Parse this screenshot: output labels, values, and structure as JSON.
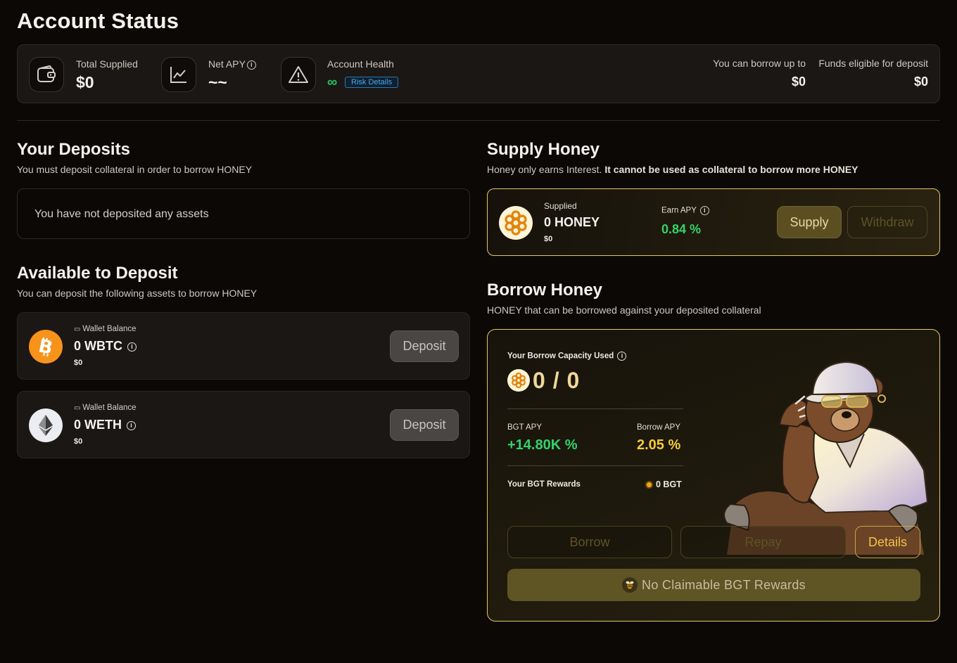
{
  "page": {
    "title": "Account Status"
  },
  "status": {
    "total_supplied_label": "Total Supplied",
    "total_supplied_value": "$0",
    "net_apy_label": "Net APY",
    "net_apy_value": "~~",
    "account_health_label": "Account Health",
    "account_health_value": "∞",
    "risk_details_label": "Risk Details",
    "borrow_up_to_label": "You can borrow up to",
    "borrow_up_to_value": "$0",
    "funds_eligible_label": "Funds eligible for deposit",
    "funds_eligible_value": "$0"
  },
  "deposits": {
    "title": "Your Deposits",
    "subtitle": "You must deposit collateral in order to borrow HONEY",
    "empty_text": "You have not deposited any assets"
  },
  "available": {
    "title": "Available to Deposit",
    "subtitle": "You can deposit the following assets to borrow HONEY",
    "assets": [
      {
        "wallet_label": "Wallet Balance",
        "amount": "0 WBTC",
        "usd": "$0",
        "button": "Deposit",
        "icon": "bitcoin-icon",
        "color": "#f7931a"
      },
      {
        "wallet_label": "Wallet Balance",
        "amount": "0 WETH",
        "usd": "$0",
        "button": "Deposit",
        "icon": "ethereum-icon",
        "color": "#ecedf0"
      }
    ]
  },
  "supply": {
    "title": "Supply Honey",
    "subtitle_plain": "Honey only earns Interest.",
    "subtitle_bold": "It cannot be used as collateral to borrow more HONEY",
    "supplied_label": "Supplied",
    "supplied_amount": "0 HONEY",
    "supplied_usd": "$0",
    "earn_apy_label": "Earn APY",
    "earn_apy_value": "0.84 %",
    "supply_button": "Supply",
    "withdraw_button": "Withdraw"
  },
  "borrow": {
    "title": "Borrow Honey",
    "subtitle": "HONEY that can be borrowed against your deposited collateral",
    "capacity_label": "Your Borrow Capacity Used",
    "capacity_value": "0 / 0",
    "bgt_apy_label": "BGT APY",
    "bgt_apy_value": "+14.80K %",
    "borrow_apy_label": "Borrow APY",
    "borrow_apy_value": "2.05 %",
    "rewards_label": "Your BGT Rewards",
    "rewards_value": "0 BGT",
    "borrow_button": "Borrow",
    "repay_button": "Repay",
    "details_button": "Details",
    "claim_button": "No Claimable BGT Rewards"
  },
  "colors": {
    "background": "#0c0806",
    "gold_border": "#e3c56c",
    "green": "#34d36a",
    "yellow": "#f4cc3a",
    "link_blue": "#4ea7e6"
  }
}
